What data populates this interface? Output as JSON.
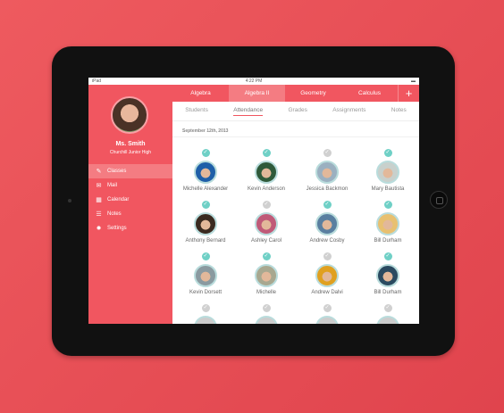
{
  "status": {
    "device": "iPad",
    "time": "4:22 PM"
  },
  "teacher": {
    "name": "Ms. Smith",
    "school": "Churchill Junior High"
  },
  "menu": [
    {
      "label": "Classes",
      "icon": "pencil-icon"
    },
    {
      "label": "Mail",
      "icon": "mail-icon"
    },
    {
      "label": "Calendar",
      "icon": "calendar-icon"
    },
    {
      "label": "Notes",
      "icon": "list-icon"
    },
    {
      "label": "Settings",
      "icon": "gear-icon"
    }
  ],
  "tabs": [
    "Algebra",
    "Algebra II",
    "Geometry",
    "Calculus"
  ],
  "selected_tab": "Algebra II",
  "add_label": "+",
  "subtabs": [
    "Students",
    "Attendance",
    "Grades",
    "Assignments",
    "Notes"
  ],
  "selected_subtab": "Attendance",
  "date": "September 12th, 2013",
  "colors": {
    "accent": "#f15660",
    "check": "#6fd0c6"
  },
  "students": [
    {
      "name": "Michelle Alexander",
      "present": true,
      "color": "#1f5fa8"
    },
    {
      "name": "Kevin Anderson",
      "present": true,
      "color": "#2f5a3a"
    },
    {
      "name": "Jessica Backmon",
      "present": false,
      "color": "#9bb0c0"
    },
    {
      "name": "Mary Bautista",
      "present": true,
      "color": "#c8d0cc"
    },
    {
      "name": "Anthony Bernard",
      "present": true,
      "color": "#3a2a20"
    },
    {
      "name": "Ashley Carol",
      "present": false,
      "color": "#c05a78"
    },
    {
      "name": "Andrew Cosby",
      "present": true,
      "color": "#5a7fa0"
    },
    {
      "name": "Bill Durham",
      "present": true,
      "color": "#e8c070"
    },
    {
      "name": "Kevin Dorsett",
      "present": true,
      "color": "#8a9aa0"
    },
    {
      "name": "Michelle",
      "present": true,
      "color": "#a8a890"
    },
    {
      "name": "Andrew Dalvi",
      "present": false,
      "color": "#e0a020"
    },
    {
      "name": "Bill Durham",
      "present": true,
      "color": "#2a4a60"
    }
  ]
}
